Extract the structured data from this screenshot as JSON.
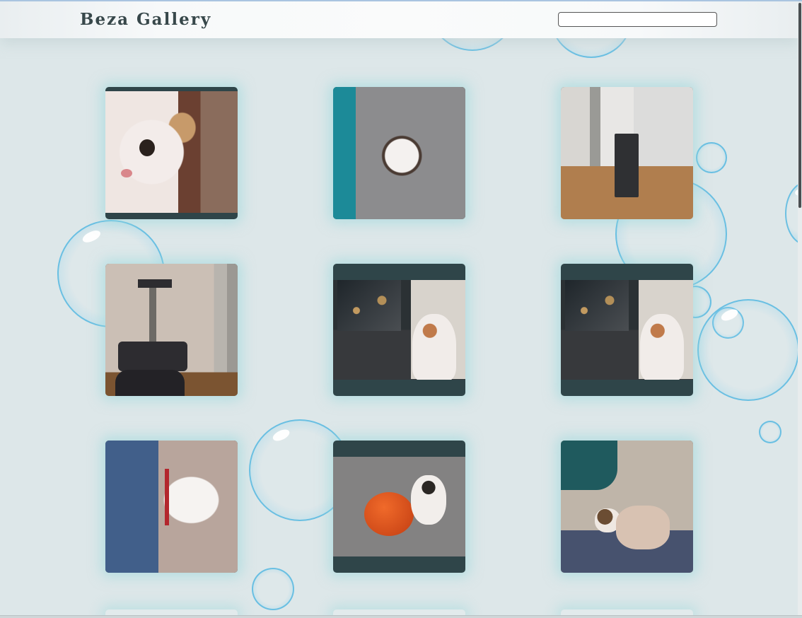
{
  "header": {
    "title": "Beza Gallery",
    "search": {
      "value": "",
      "placeholder": ""
    }
  },
  "gallery": {
    "items": [
      {
        "label": "kitten-closeup"
      },
      {
        "label": "kitten-sleeping-on-rug"
      },
      {
        "label": "cat-tree-in-room"
      },
      {
        "label": "kitten-on-cat-tree"
      },
      {
        "label": "kitten-in-front-of-laptop"
      },
      {
        "label": "kitten-in-front-of-laptop-2"
      },
      {
        "label": "kitten-sleeping-on-blanket"
      },
      {
        "label": "kitten-with-pumpkin"
      },
      {
        "label": "kitten-with-plush"
      }
    ]
  },
  "colors": {
    "background": "#dde7e9",
    "tile_frame": "#2f4549",
    "bubble": "#58b9e1",
    "title": "#37474a"
  }
}
